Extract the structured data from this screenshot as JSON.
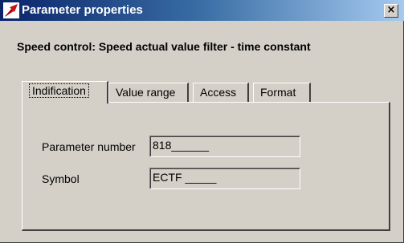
{
  "window": {
    "title": "Parameter properties",
    "close_glyph": "×",
    "icon": "parameter-app-icon"
  },
  "heading": "Speed control: Speed actual value filter - time constant",
  "tabs": [
    {
      "label": "Indification",
      "active": true
    },
    {
      "label": "Value range",
      "active": false
    },
    {
      "label": "Access",
      "active": false
    },
    {
      "label": "Format",
      "active": false
    }
  ],
  "fields": {
    "parameter_number": {
      "label": "Parameter number",
      "value": "818______"
    },
    "symbol": {
      "label": "Symbol",
      "value": "ECTF _____"
    }
  },
  "colors": {
    "window_face": "#d4d0c8",
    "title_active_start": "#0a246a",
    "title_active_end": "#a6caf0",
    "icon_red": "#cc1111"
  }
}
